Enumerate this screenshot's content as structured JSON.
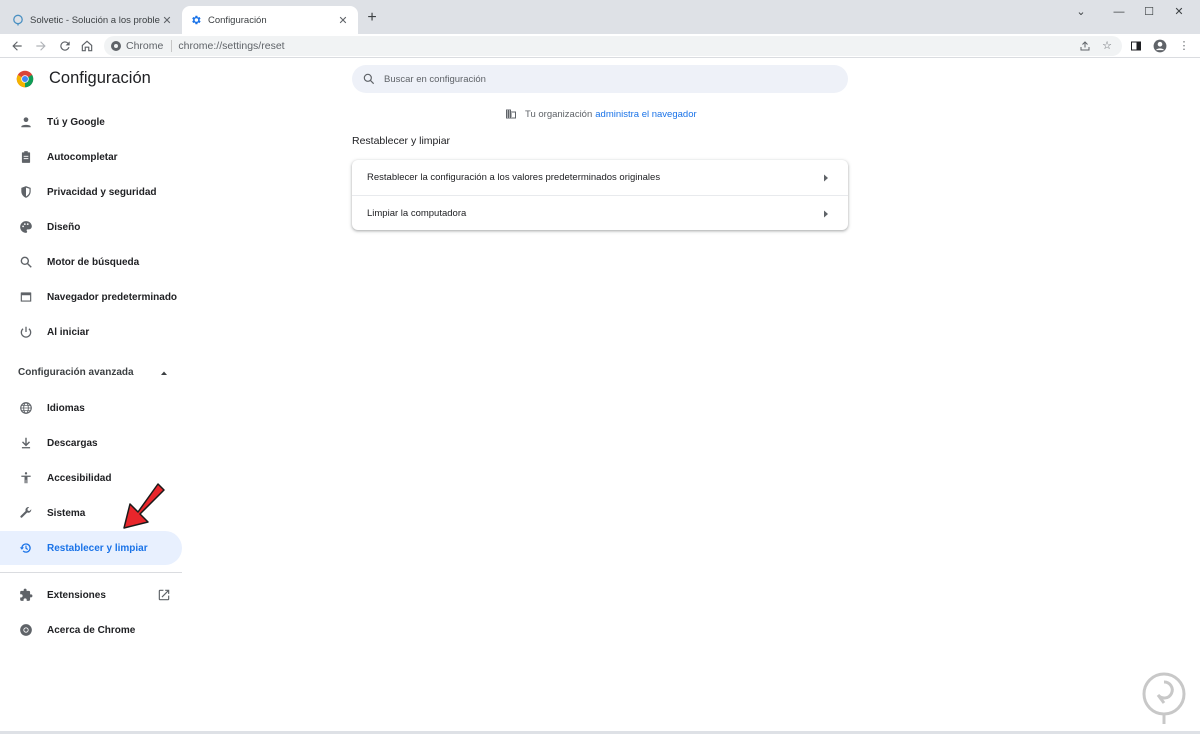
{
  "tabs": [
    {
      "title": "Solvetic - Solución a los problemas",
      "active": false
    },
    {
      "title": "Configuración",
      "active": true
    }
  ],
  "toolbar": {
    "site_label": "Chrome",
    "url": "chrome://settings/reset"
  },
  "settings": {
    "title": "Configuración",
    "search_placeholder": "Buscar en configuración"
  },
  "sidebar": {
    "items": [
      {
        "label": "Tú y Google",
        "icon": "person-icon"
      },
      {
        "label": "Autocompletar",
        "icon": "clipboard-icon"
      },
      {
        "label": "Privacidad y seguridad",
        "icon": "shield-icon"
      },
      {
        "label": "Diseño",
        "icon": "palette-icon"
      },
      {
        "label": "Motor de búsqueda",
        "icon": "search-icon"
      },
      {
        "label": "Navegador predeterminado",
        "icon": "browser-icon"
      },
      {
        "label": "Al iniciar",
        "icon": "power-icon"
      }
    ],
    "advanced_label": "Configuración avanzada",
    "advanced_items": [
      {
        "label": "Idiomas",
        "icon": "globe-icon"
      },
      {
        "label": "Descargas",
        "icon": "download-icon"
      },
      {
        "label": "Accesibilidad",
        "icon": "accessibility-icon"
      },
      {
        "label": "Sistema",
        "icon": "wrench-icon"
      },
      {
        "label": "Restablecer y limpiar",
        "icon": "restore-icon",
        "active": true
      }
    ],
    "footer_items": [
      {
        "label": "Extensiones",
        "icon": "puzzle-icon"
      },
      {
        "label": "Acerca de Chrome",
        "icon": "chrome-icon"
      }
    ]
  },
  "main": {
    "managed_prefix": "Tu organización",
    "managed_link": "administra el navegador",
    "section_title": "Restablecer y limpiar",
    "rows": [
      {
        "label": "Restablecer la configuración a los valores predeterminados originales"
      },
      {
        "label": "Limpiar la computadora"
      }
    ]
  },
  "colors": {
    "accent": "#1a73e8",
    "active_bg": "#e8f0fe",
    "tabstrip": "#dee1e6",
    "annotation_arrow": "#e8262b"
  }
}
